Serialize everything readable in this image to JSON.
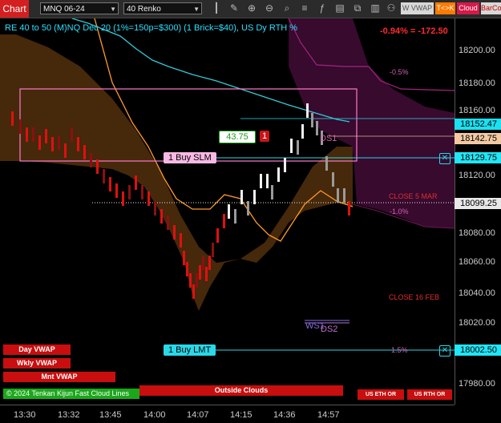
{
  "toolbar": {
    "chart_label": "Chart",
    "instrument": "MNQ 06-24",
    "bar_type": "40 Renko",
    "icons": [
      "bar-style-icon",
      "draw-icon",
      "zoom-in-icon",
      "zoom-out-icon",
      "properties-icon",
      "strategy-icon",
      "indicator-icon",
      "templates-icon",
      "copy-icon",
      "bar-grid-icon",
      "people-icon"
    ],
    "btn_wvwap": "W VWAP",
    "btn_tk": "T<>K",
    "btn_cloud": "Cloud",
    "btn_barco": "BarCo"
  },
  "header": {
    "title": "RE 40 to 50 (M)NQ Dec 20 (1%=150p=$300) (1 Brick=$40), US Dy RTH %",
    "pnl": "-0.94% = -172.50"
  },
  "price_axis": {
    "ticks": [
      "18200.00",
      "18180.00",
      "18160.00",
      "18120.00",
      "18080.00",
      "18060.00",
      "18040.00",
      "18020.00",
      "17980.00"
    ],
    "tags": [
      {
        "label": "18152.47",
        "price": 18152.47,
        "bg": "#1ce0f0",
        "fg": "#000"
      },
      {
        "label": "18142.75",
        "price": 18142.75,
        "bg": "#f3c9a3",
        "fg": "#000"
      },
      {
        "label": "18129.75",
        "price": 18129.75,
        "bg": "#22e5f5",
        "fg": "#000"
      },
      {
        "label": "18099.25",
        "price": 18099.25,
        "bg": "#e8e8e8",
        "fg": "#000"
      },
      {
        "label": "18002.50",
        "price": 18002.5,
        "bg": "#22e5f5",
        "fg": "#000"
      }
    ]
  },
  "time_axis": {
    "ticks": [
      "13:30",
      "13:32",
      "13:45",
      "14:00",
      "14:07",
      "14:15",
      "14:36",
      "14:57"
    ]
  },
  "levels": {
    "minus_half": "-0.5%",
    "close_mar": "CLOSE 5 MAR",
    "minus_one": "-1.0%",
    "close_feb": "CLOSE 16 FEB",
    "one_five": "1.5%",
    "ds1": "DS1",
    "ws1": "WS1",
    "ds2": "DS2"
  },
  "orders": {
    "target_value": "43.75",
    "target_qty": "1",
    "stop_label": "1 Buy SLM",
    "limit_label": "1 Buy LMT",
    "close_x": "✕"
  },
  "bottom_buttons": {
    "day_vwap": "Day VWAP",
    "wkly_vwap": "Wkly VWAP",
    "mnt_vwap": "Mnt VWAP",
    "tenkan": "© 2024 Tenkan Kijun Fast Cloud Lines",
    "outside_clouds": "Outside Clouds",
    "us_eth_or": "US ETH OR",
    "us_rth_or": "US RTH OR"
  },
  "colors": {
    "up_brick": "#f0f0f0",
    "down_brick": "#e01010",
    "cloud_orange": "#5a3510",
    "cloud_magenta": "#3c0d32",
    "line_cyan": "#33c9d6",
    "line_orange": "#ff9a2a"
  }
}
